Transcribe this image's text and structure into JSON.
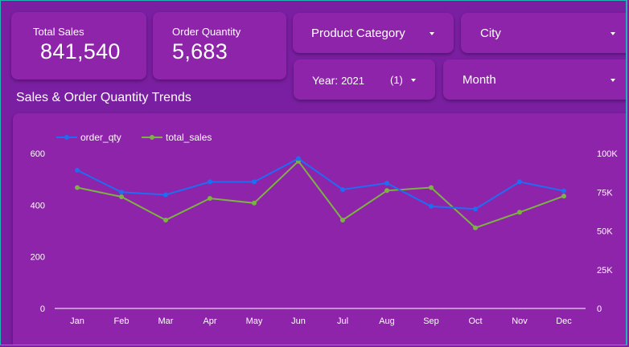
{
  "kpis": {
    "total_sales": {
      "label": "Total Sales",
      "value": "841,540"
    },
    "order_quantity": {
      "label": "Order Quantity",
      "value": "5,683"
    }
  },
  "filters": {
    "product_category": {
      "label": "Product Category"
    },
    "city": {
      "label": "City"
    },
    "year": {
      "label": "Year:",
      "value": "2021",
      "count": "(1)"
    },
    "month": {
      "label": "Month"
    }
  },
  "section_title": "Sales & Order Quantity Trends",
  "colors": {
    "background": "#7b1fa2",
    "card": "#8e24aa",
    "order_qty": "#1e6df2",
    "total_sales": "#7cb342",
    "border": "#27b3b5"
  },
  "chart_data": {
    "type": "line",
    "categories": [
      "Jan",
      "Feb",
      "Mar",
      "Apr",
      "May",
      "Jun",
      "Jul",
      "Aug",
      "Sep",
      "Oct",
      "Nov",
      "Dec"
    ],
    "series": [
      {
        "name": "order_qty",
        "axis": "left",
        "values": [
          535,
          450,
          440,
          490,
          490,
          580,
          460,
          485,
          395,
          385,
          490,
          455
        ]
      },
      {
        "name": "total_sales",
        "axis": "right",
        "values": [
          78000,
          72000,
          57000,
          71000,
          68000,
          95000,
          57000,
          76000,
          78000,
          52000,
          62000,
          72500
        ]
      }
    ],
    "left_axis": {
      "ticks": [
        "0",
        "200",
        "400",
        "600"
      ],
      "ylim": [
        0,
        600
      ]
    },
    "right_axis": {
      "ticks": [
        "0",
        "25K",
        "50K",
        "75K",
        "100K"
      ],
      "ylim": [
        0,
        100000
      ]
    },
    "legend": "top-left",
    "grid": false
  }
}
